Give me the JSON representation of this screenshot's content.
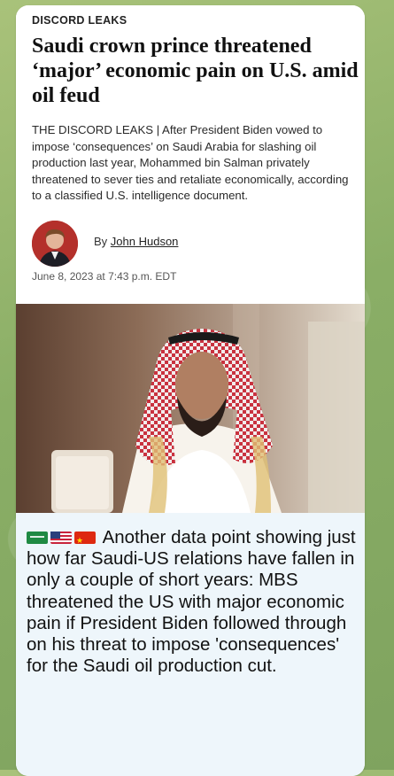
{
  "article": {
    "kicker": "DISCORD LEAKS",
    "headline": "Saudi crown prince threatened ‘major’ economic pain on U.S. amid oil feud",
    "dek": "THE DISCORD LEAKS | After President Biden vowed to impose ‘consequences’ on Saudi Arabia for slashing oil production last year, Mohammed bin Salman privately threatened to sever ties and retaliate economically, according to a classified U.S. intelligence document.",
    "byline_prefix": "By",
    "author": "John Hudson",
    "date": "June 8, 2023 at 7:43 p.m. EDT"
  },
  "message": {
    "flags": [
      "saudi-arabia-flag-icon",
      "united-states-flag-icon",
      "china-flag-icon"
    ],
    "text": "Another data point showing just how far Saudi-US relations have fallen in only a couple of short years: MBS threatened the US with major economic pain if President Biden followed through on his threat to impose 'consequences' for the Saudi oil production cut."
  },
  "colors": {
    "background": "#8fb36a",
    "bubble": "#ffffff",
    "message_panel": "#eef6fb",
    "avatar": "#b4302b"
  }
}
